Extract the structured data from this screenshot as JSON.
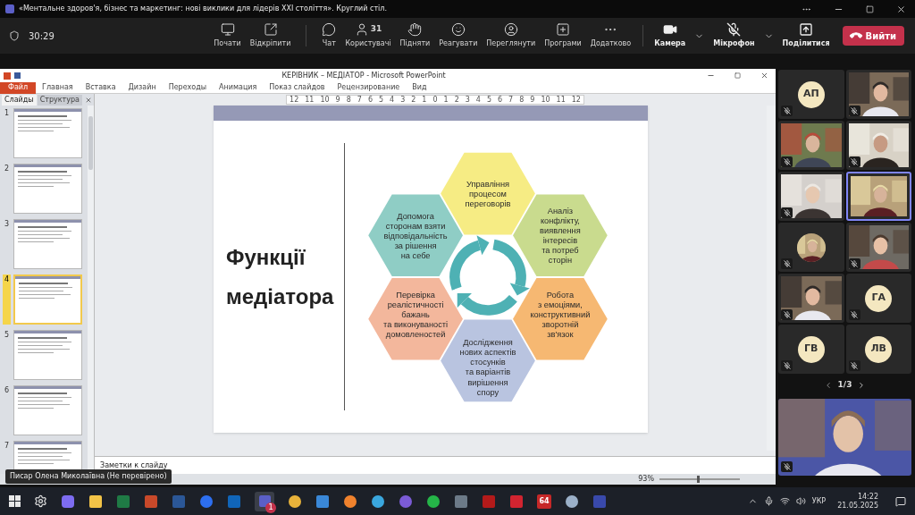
{
  "meeting": {
    "title": "«Ментальне здоров'я, бізнес та маркетинг: нові виклики для лідерів XXI століття». Круглий стіл.",
    "timer": "30:29",
    "toolbar": [
      {
        "kind": "record",
        "label": "Почати"
      },
      {
        "kind": "unpin",
        "label": "Відкріпити"
      },
      {
        "kind": "chat",
        "label": "Чат"
      },
      {
        "kind": "people",
        "label": "Користувачі",
        "count": "31"
      },
      {
        "kind": "hand",
        "label": "Підняти"
      },
      {
        "kind": "react",
        "label": "Реагувати"
      },
      {
        "kind": "view",
        "label": "Переглянути"
      },
      {
        "kind": "apps",
        "label": "Програми"
      },
      {
        "kind": "more",
        "label": "Додатково"
      }
    ],
    "camera": {
      "label": "Камера",
      "on": true
    },
    "mic": {
      "label": "Мікрофон",
      "muted": true
    },
    "share": "Поділитися",
    "leave": "Вийти"
  },
  "powerpoint": {
    "title": "КЕРІВНИК – МЕДІАТОР  -  Microsoft PowerPoint",
    "ribbon_tabs": [
      {
        "label": "Файл",
        "kind": "file"
      },
      {
        "label": "Главная",
        "kind": "tab"
      },
      {
        "label": "Вставка",
        "kind": "tab"
      },
      {
        "label": "Дизайн",
        "kind": "tab"
      },
      {
        "label": "Переходы",
        "kind": "tab"
      },
      {
        "label": "Анимация",
        "kind": "tab"
      },
      {
        "label": "Показ слайдов",
        "kind": "tab"
      },
      {
        "label": "Рецензирование",
        "kind": "tab"
      },
      {
        "label": "Вид",
        "kind": "tab"
      }
    ],
    "pane_tabs": [
      {
        "label": "Слайды",
        "selected": true
      },
      {
        "label": "Структура",
        "selected": false
      }
    ],
    "ruler": [
      "12",
      "11",
      "10",
      "9",
      "8",
      "7",
      "6",
      "5",
      "4",
      "3",
      "2",
      "1",
      "0",
      "1",
      "2",
      "3",
      "4",
      "5",
      "6",
      "7",
      "8",
      "9",
      "10",
      "11",
      "12"
    ],
    "thumbnails": [
      {
        "number": "1",
        "selected": false
      },
      {
        "number": "2",
        "selected": false
      },
      {
        "number": "3",
        "selected": false
      },
      {
        "number": "4",
        "selected": true
      },
      {
        "number": "5",
        "selected": false
      },
      {
        "number": "6",
        "selected": false
      },
      {
        "number": "7",
        "selected": false
      }
    ],
    "slide": {
      "title": "Функції медіатора",
      "hexagons": [
        {
          "lines": [
            "Управління",
            "процесом",
            "переговорів"
          ],
          "color": "#f6ec84"
        },
        {
          "lines": [
            "Допомога",
            "сторонам взяти",
            "відповідальність",
            "за рішення",
            "на себе"
          ],
          "color": "#8fcdc5"
        },
        {
          "lines": [
            "Аналіз",
            "конфлікту,",
            "виявлення",
            "інтересів",
            "та потреб",
            "сторін"
          ],
          "color": "#c9db8e"
        },
        {
          "lines": [
            "Перевірка",
            "реалістичності",
            "бажань",
            "та виконуваності",
            "домовленостей"
          ],
          "color": "#f3b79c"
        },
        {
          "lines": [
            "Робота",
            "з емоціями,",
            "конструктивний",
            "зворотній",
            "зв'язок"
          ],
          "color": "#f6b872"
        },
        {
          "lines": [
            "Дослідження",
            "нових аспектів",
            "стосунків",
            "та варіантів",
            "вирішення",
            "спору"
          ],
          "color": "#b9c4e0"
        }
      ]
    },
    "notes_placeholder": "Заметки к слайду",
    "zoom": "93%",
    "zoom_slider": {
      "level": 0.48
    }
  },
  "presenter_tag": "Писар Олена Миколаївна (Не перевірено)",
  "participants": [
    {
      "kind": "initials",
      "initials": "АП",
      "speaking": false,
      "muted": true
    },
    {
      "kind": "video",
      "speaking": false,
      "muted": true
    },
    {
      "kind": "video",
      "speaking": false,
      "muted": true
    },
    {
      "kind": "video",
      "speaking": false,
      "muted": true
    },
    {
      "kind": "video",
      "speaking": false,
      "muted": true
    },
    {
      "kind": "video",
      "speaking": true,
      "muted": false
    },
    {
      "kind": "avatar",
      "speaking": false,
      "muted": true
    },
    {
      "kind": "video",
      "speaking": false,
      "muted": true
    },
    {
      "kind": "video",
      "speaking": false,
      "muted": true
    },
    {
      "kind": "initials",
      "initials": "ГА",
      "speaking": false,
      "muted": true
    },
    {
      "kind": "initials",
      "initials": "ГВ",
      "speaking": false,
      "muted": true
    },
    {
      "kind": "initials",
      "initials": "ЛВ",
      "speaking": false,
      "muted": true
    }
  ],
  "pagination": "1/3",
  "taskbar": {
    "app_64": "64",
    "teams_badge": "1",
    "language": "УКР",
    "time": "14:22",
    "date": "21.05.2025"
  }
}
